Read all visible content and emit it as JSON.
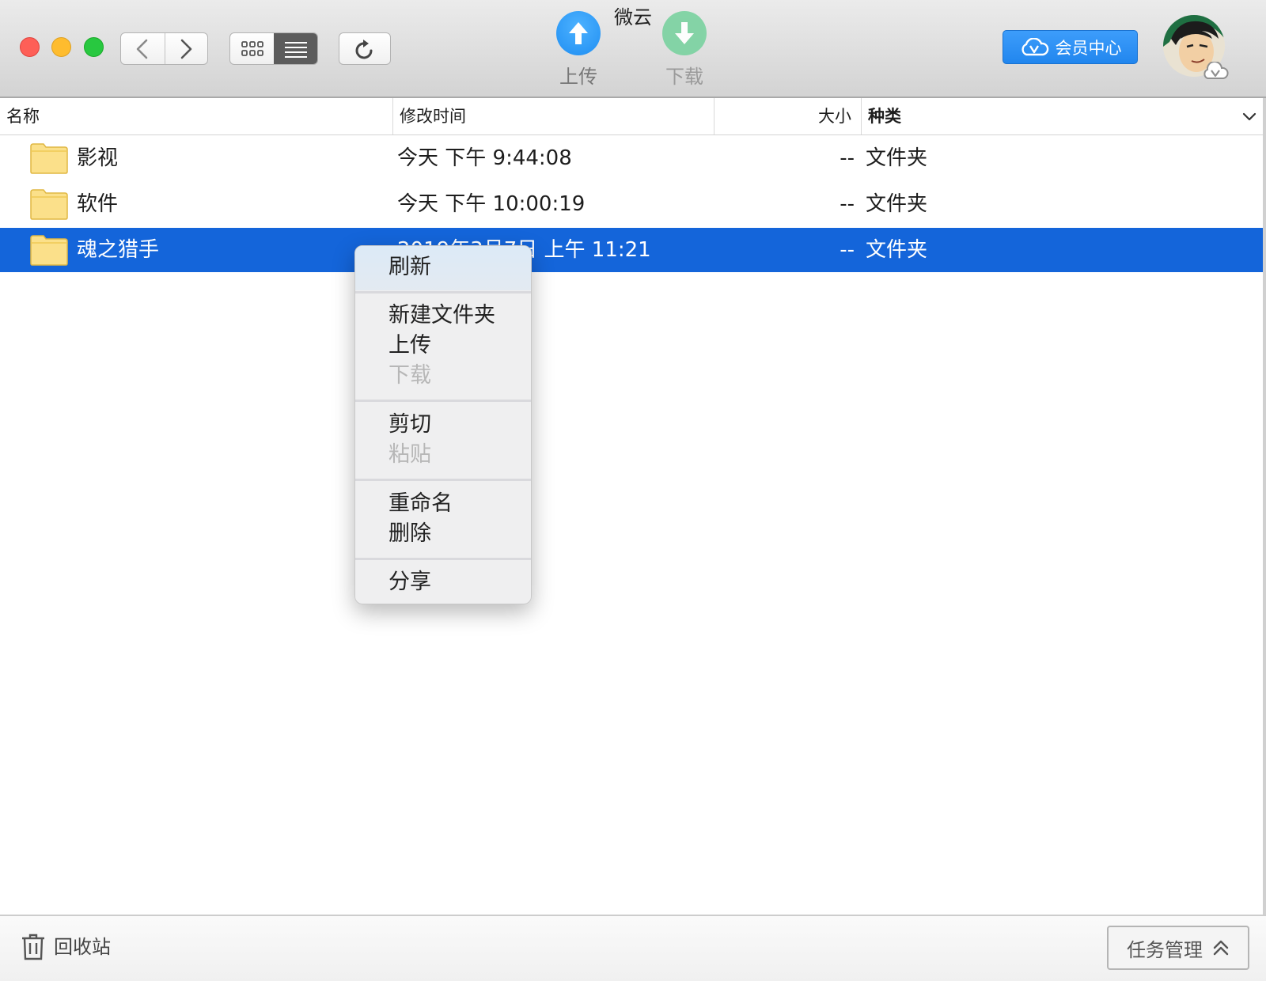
{
  "window": {
    "title": "微云"
  },
  "toolbar": {
    "upload_label": "上传",
    "download_label": "下载",
    "vip_label": "会员中心"
  },
  "columns": {
    "name": "名称",
    "mtime": "修改时间",
    "size": "大小",
    "kind": "种类"
  },
  "files": [
    {
      "name": "影视",
      "mtime": "今天 下午 9:44:08",
      "size": "--",
      "kind": "文件夹",
      "selected": false
    },
    {
      "name": "软件",
      "mtime": "今天 下午 10:00:19",
      "size": "--",
      "kind": "文件夹",
      "selected": false
    },
    {
      "name": "魂之猎手",
      "mtime": "2019年3月7日 上午 11:21",
      "size": "--",
      "kind": "文件夹",
      "selected": true
    }
  ],
  "context_menu": {
    "refresh": "刷新",
    "new_folder": "新建文件夹",
    "upload": "上传",
    "download": "下载",
    "cut": "剪切",
    "paste": "粘贴",
    "rename": "重命名",
    "delete": "删除",
    "share": "分享"
  },
  "bottombar": {
    "trash_label": "回收站",
    "task_label": "任务管理"
  },
  "colors": {
    "selection": "#1465da",
    "accent": "#2186ee",
    "folder": "#fbe08a"
  }
}
